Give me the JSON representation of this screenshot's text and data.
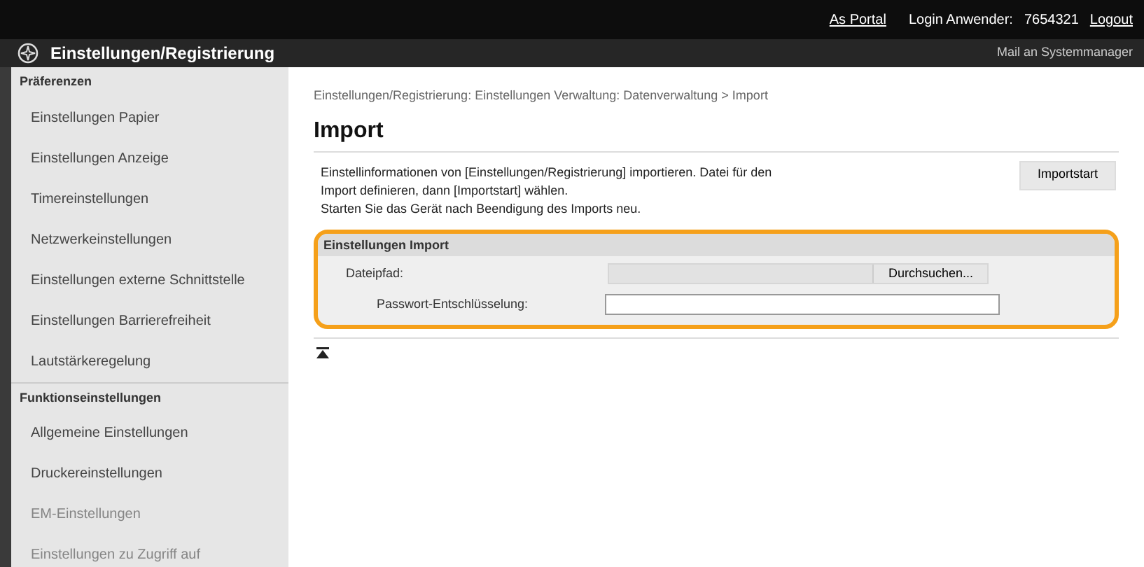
{
  "top_bar": {
    "links": [
      "As Portal"
    ],
    "login_label": "Login Anwender:",
    "login_id": "7654321",
    "logout": "Logout"
  },
  "header": {
    "title": "Einstellungen/Registrierung",
    "mail_link": "Mail an Systemmanager"
  },
  "sidebar": {
    "sections": [
      {
        "title": "Präferenzen",
        "items": [
          {
            "label": "Einstellungen Papier",
            "faded": false
          },
          {
            "label": "Einstellungen Anzeige",
            "faded": false
          },
          {
            "label": "Timereinstellungen",
            "faded": false
          },
          {
            "label": "Netzwerkeinstellungen",
            "faded": false
          },
          {
            "label": "Einstellungen externe Schnittstelle",
            "faded": false
          },
          {
            "label": "Einstellungen Barrierefreiheit",
            "faded": false
          },
          {
            "label": "Lautstärkeregelung",
            "faded": false
          }
        ]
      },
      {
        "title": "Funktionseinstellungen",
        "items": [
          {
            "label": "Allgemeine Einstellungen",
            "faded": false
          },
          {
            "label": "Druckereinstellungen",
            "faded": false
          },
          {
            "label": "EM-Einstellungen",
            "faded": true
          },
          {
            "label": "Einstellungen zu Zugriff auf",
            "faded": true
          }
        ]
      }
    ]
  },
  "breadcrumb": "Einstellungen/Registrierung: Einstellungen Verwaltung: Datenverwaltung > Import",
  "page_title": "Import",
  "description": [
    "Einstellinformationen von [Einstellungen/Registrierung] importieren. Datei für den Import definieren, dann [Importstart] wählen.",
    "Starten Sie das Gerät nach Beendigung des Imports neu."
  ],
  "start_button": "Importstart",
  "section": {
    "title": "Einstellungen Import",
    "highlighted": true,
    "file_path": {
      "label": "Dateipfad:",
      "browse_button": "Durchsuchen..."
    },
    "password": {
      "label": "Passwort-Entschlüsselung:"
    }
  }
}
